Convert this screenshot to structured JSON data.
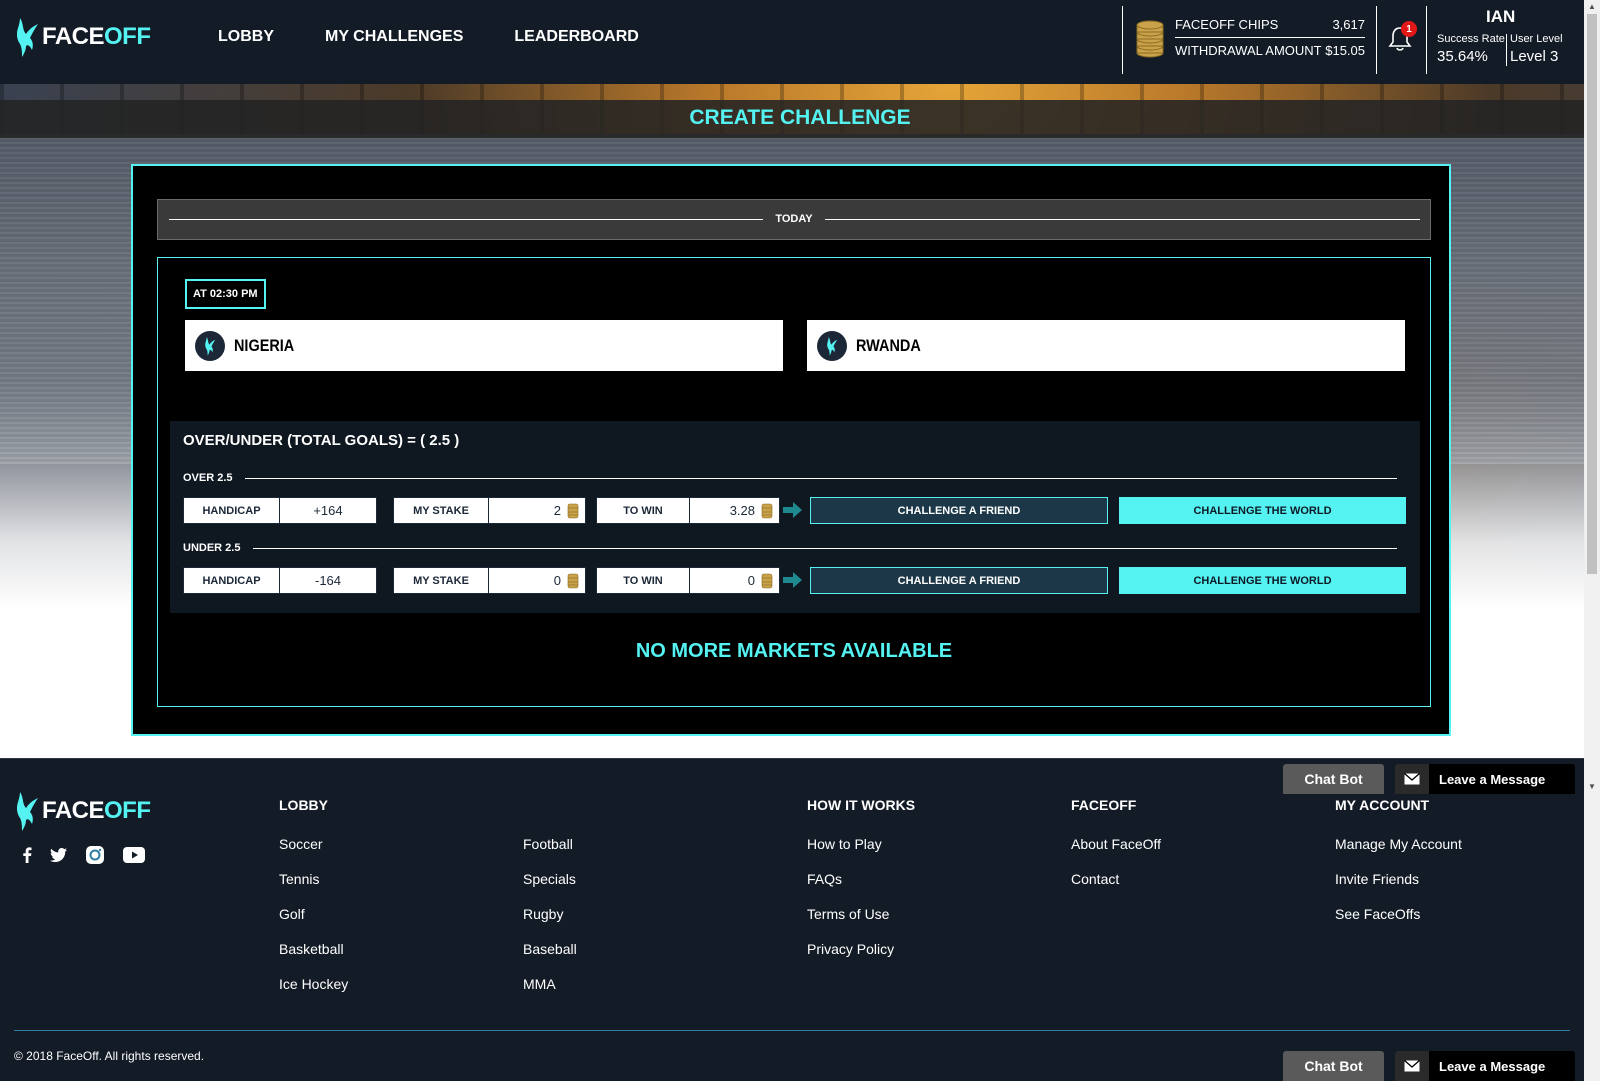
{
  "brand": {
    "face": "FACE",
    "off": "OFF"
  },
  "nav": {
    "lobby": "LOBBY",
    "my_challenges": "MY CHALLENGES",
    "leaderboard": "LEADERBOARD"
  },
  "wallet": {
    "chips_label": "FACEOFF CHIPS",
    "chips_value": "3,617",
    "withdrawal_label": "WITHDRAWAL AMOUNT",
    "withdrawal_value": "$15.05"
  },
  "notifications": {
    "count": "1"
  },
  "user": {
    "name": "IAN",
    "success_rate_label": "Success Rate",
    "success_rate_value": "35.64%",
    "level_label": "User Level",
    "level_value": "Level 3"
  },
  "page_title": "CREATE CHALLENGE",
  "day_label": "TODAY",
  "match": {
    "time": "AT 02:30 PM",
    "home": "NIGERIA",
    "away": "RWANDA"
  },
  "market": {
    "title": "OVER/UNDER (TOTAL GOALS) = ( 2.5 )",
    "rows": [
      {
        "label": "OVER 2.5",
        "handicap_label": "HANDICAP",
        "handicap": "+164",
        "stake_label": "MY STAKE",
        "stake": "2",
        "towin_label": "TO WIN",
        "towin": "3.28",
        "friend": "CHALLENGE A FRIEND",
        "world": "CHALLENGE THE WORLD"
      },
      {
        "label": "UNDER 2.5",
        "handicap_label": "HANDICAP",
        "handicap": "-164",
        "stake_label": "MY STAKE",
        "stake": "0",
        "towin_label": "TO WIN",
        "towin": "0",
        "friend": "CHALLENGE A FRIEND",
        "world": "CHALLENGE THE WORLD"
      }
    ]
  },
  "no_more": "NO MORE MARKETS AVAILABLE",
  "footer": {
    "lobby_title": "LOBBY",
    "lobby_col1": [
      "Soccer",
      "Tennis",
      "Golf",
      "Basketball",
      "Ice Hockey"
    ],
    "lobby_col2": [
      "Football",
      "Specials",
      "Rugby",
      "Baseball",
      "MMA"
    ],
    "how_title": "HOW IT WORKS",
    "how_links": [
      "How to Play",
      "FAQs",
      "Terms of Use",
      "Privacy Policy"
    ],
    "faceoff_title": "FACEOFF",
    "faceoff_links": [
      "About FaceOff",
      "Contact"
    ],
    "account_title": "MY ACCOUNT",
    "account_links": [
      "Manage My Account",
      "Invite Friends",
      "See FaceOffs"
    ],
    "copyright": "© 2018 FaceOff. All rights reserved."
  },
  "chat": {
    "chatbot": "Chat Bot",
    "leave_message": "Leave a Message"
  },
  "colors": {
    "accent": "#55f2f2",
    "navy": "#131b26",
    "coin": "#c9a24a",
    "badge": "#e21818"
  }
}
